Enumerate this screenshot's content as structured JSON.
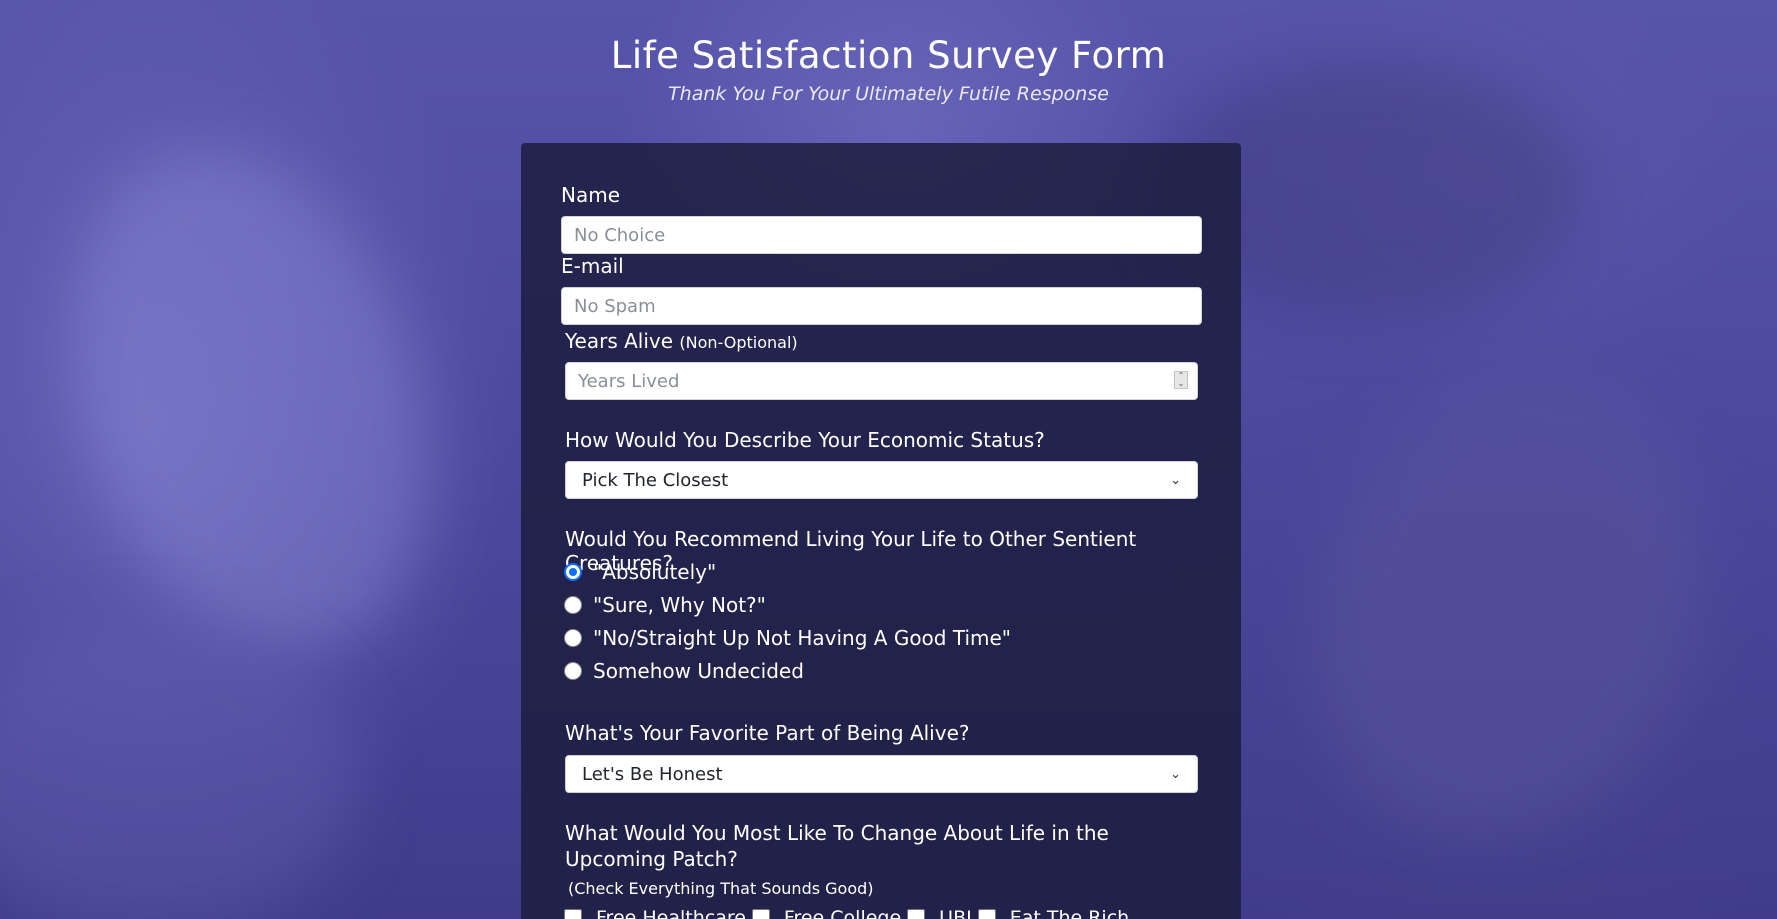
{
  "header": {
    "title": "Life Satisfaction Survey Form",
    "subtitle": "Thank You For Your Ultimately Futile Response"
  },
  "form": {
    "name": {
      "label": "Name",
      "placeholder": "No Choice"
    },
    "email": {
      "label": "E-mail",
      "placeholder": "No Spam"
    },
    "years": {
      "label": "Years Alive",
      "label_note": "(Non-Optional)",
      "placeholder": "Years Lived"
    },
    "economic": {
      "label": "How Would You Describe Your Economic Status?",
      "selected": "Pick The Closest"
    },
    "recommend": {
      "label": "Would You Recommend Living Your Life to Other Sentient Creatures?",
      "options": [
        "\"Absolutely\"",
        "\"Sure, Why Not?\"",
        "\"No/Straight Up Not Having A Good Time\"",
        "Somehow Undecided"
      ],
      "selected_index": 0
    },
    "favorite": {
      "label": "What's Your Favorite Part of Being Alive?",
      "selected": "Let's Be Honest"
    },
    "change": {
      "label": "What Would You Most Like To Change About Life in the Upcoming Patch?",
      "note": "(Check Everything That Sounds Good)",
      "options": [
        "Free Healthcare",
        "Free College",
        "UBI",
        "Eat The Rich"
      ]
    }
  },
  "colors": {
    "background": "#4b479c",
    "card": "#1b1b3a",
    "accent": "#0d6efd"
  }
}
